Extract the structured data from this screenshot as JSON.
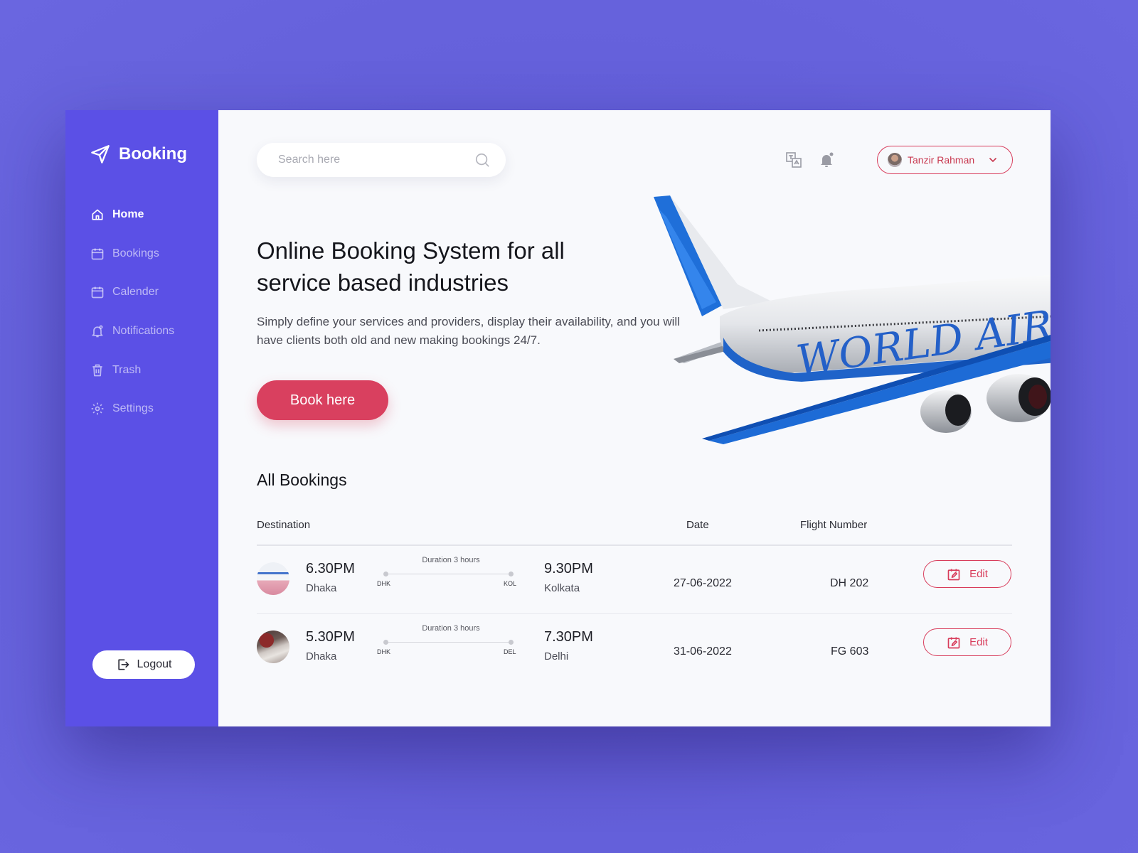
{
  "brand": {
    "name": "Booking"
  },
  "colors": {
    "primary": "#5b50e6",
    "accent": "#d9405f",
    "background": "#6663dc"
  },
  "sidebar": {
    "items": [
      {
        "label": "Home",
        "icon": "home-icon",
        "active": true
      },
      {
        "label": "Bookings",
        "icon": "calendar-icon",
        "active": false
      },
      {
        "label": "Calender",
        "icon": "calendar-icon",
        "active": false
      },
      {
        "label": "Notifications",
        "icon": "bell-icon",
        "active": false
      },
      {
        "label": "Trash",
        "icon": "trash-icon",
        "active": false
      },
      {
        "label": "Settings",
        "icon": "gear-icon",
        "active": false
      }
    ],
    "logout_label": "Logout"
  },
  "header": {
    "search_placeholder": "Search here",
    "user_name": "Tanzir Rahman"
  },
  "hero": {
    "title": "Online Booking System for all service based industries",
    "description": "Simply define your services and providers, display their availability, and you will have clients both old and new making bookings 24/7.",
    "button_label": "Book here",
    "image_text": "WORLD AIRLINES"
  },
  "bookings": {
    "title": "All Bookings",
    "columns": {
      "destination": "Destination",
      "date": "Date",
      "flight_number": "Flight Number"
    },
    "rows": [
      {
        "depart_time": "6.30PM",
        "from_city": "Dhaka",
        "duration": "Duration 3 hours",
        "from_code": "DHK",
        "to_code": "KOL",
        "arrive_time": "9.30PM",
        "to_city": "Kolkata",
        "date": "27-06-2022",
        "flight": "DH 202",
        "edit_label": "Edit"
      },
      {
        "depart_time": "5.30PM",
        "from_city": "Dhaka",
        "duration": "Duration 3 hours",
        "from_code": "DHK",
        "to_code": "DEL",
        "arrive_time": "7.30PM",
        "to_city": "Delhi",
        "date": "31-06-2022",
        "flight": "FG 603",
        "edit_label": "Edit"
      }
    ]
  }
}
